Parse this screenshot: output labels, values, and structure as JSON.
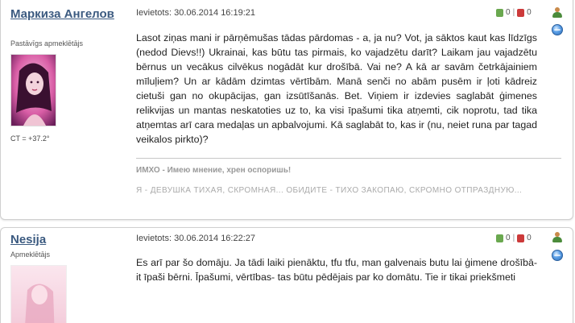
{
  "posts": [
    {
      "author": "Маркиза Ангелов",
      "role": "Pastāvīgs apmeklētājs",
      "ct": "CT = +37.2°",
      "date": "Ievietots: 30.06.2014 16:19:21",
      "likes": "0",
      "dislikes": "0",
      "text": "Lasot ziņas mani ir pārņēmušas tādas pārdomas - a, ja nu? Vot, ja sāktos kaut kas līdzīgs (nedod Dievs!!) Ukrainai, kas būtu tas pirmais, ko vajadzētu darīt? Laikam jau vajadzētu bērnus un vecākus cilvēkus nogādāt kur drošībā. Vai ne? A kā ar savām četrkājainiem mīluļiem? Un ar kādām dzimtas vērtībām. Manā senči no abām pusēm ir ļoti kādreiz cietuši gan no okupācijas, gan izsūtīšanās. Bet. Viņiem ir izdevies saglabāt ģimenes relikvijas un mantas neskatoties uz to, ka visi īpašumi tika atņemti, cik noprotu, tad tika atņemtas arī cara medaļas un apbalvojumi. Kā saglabāt to, kas ir (nu, neiet runa par tagad veikalos pirkto)?",
      "signature_title": "ИМХО - Имею мнение, хрен оспоришь!",
      "signature_text": "Я - ДЕВУШКА ТИХАЯ, СКРОМНАЯ... ОБИДИТЕ - ТИХО ЗАКОПАЮ, СКРОМНО ОТПРАЗДНУЮ..."
    },
    {
      "author": "Nesija",
      "role": "Apmeklētājs",
      "date": "Ievietots: 30.06.2014 16:22:27",
      "likes": "0",
      "dislikes": "0",
      "text": "Es arī par šo domāju. Ja tādi laiki pienāktu, tfu tfu, man galvenais butu lai ģimene drošībā- it īpaši bērni. Īpašumi, vērtības- tas būtu pēdējais par ko domātu. Tie ir tikai priekšmeti"
    }
  ],
  "colors": {
    "author_link": "#3b5a80",
    "like": "#6aa84f",
    "dislike": "#cc3a3a",
    "border": "#cfcfcf"
  },
  "icons": [
    "thumbs-up-icon",
    "thumbs-down-icon",
    "user-profile-icon",
    "globe-icon"
  ]
}
